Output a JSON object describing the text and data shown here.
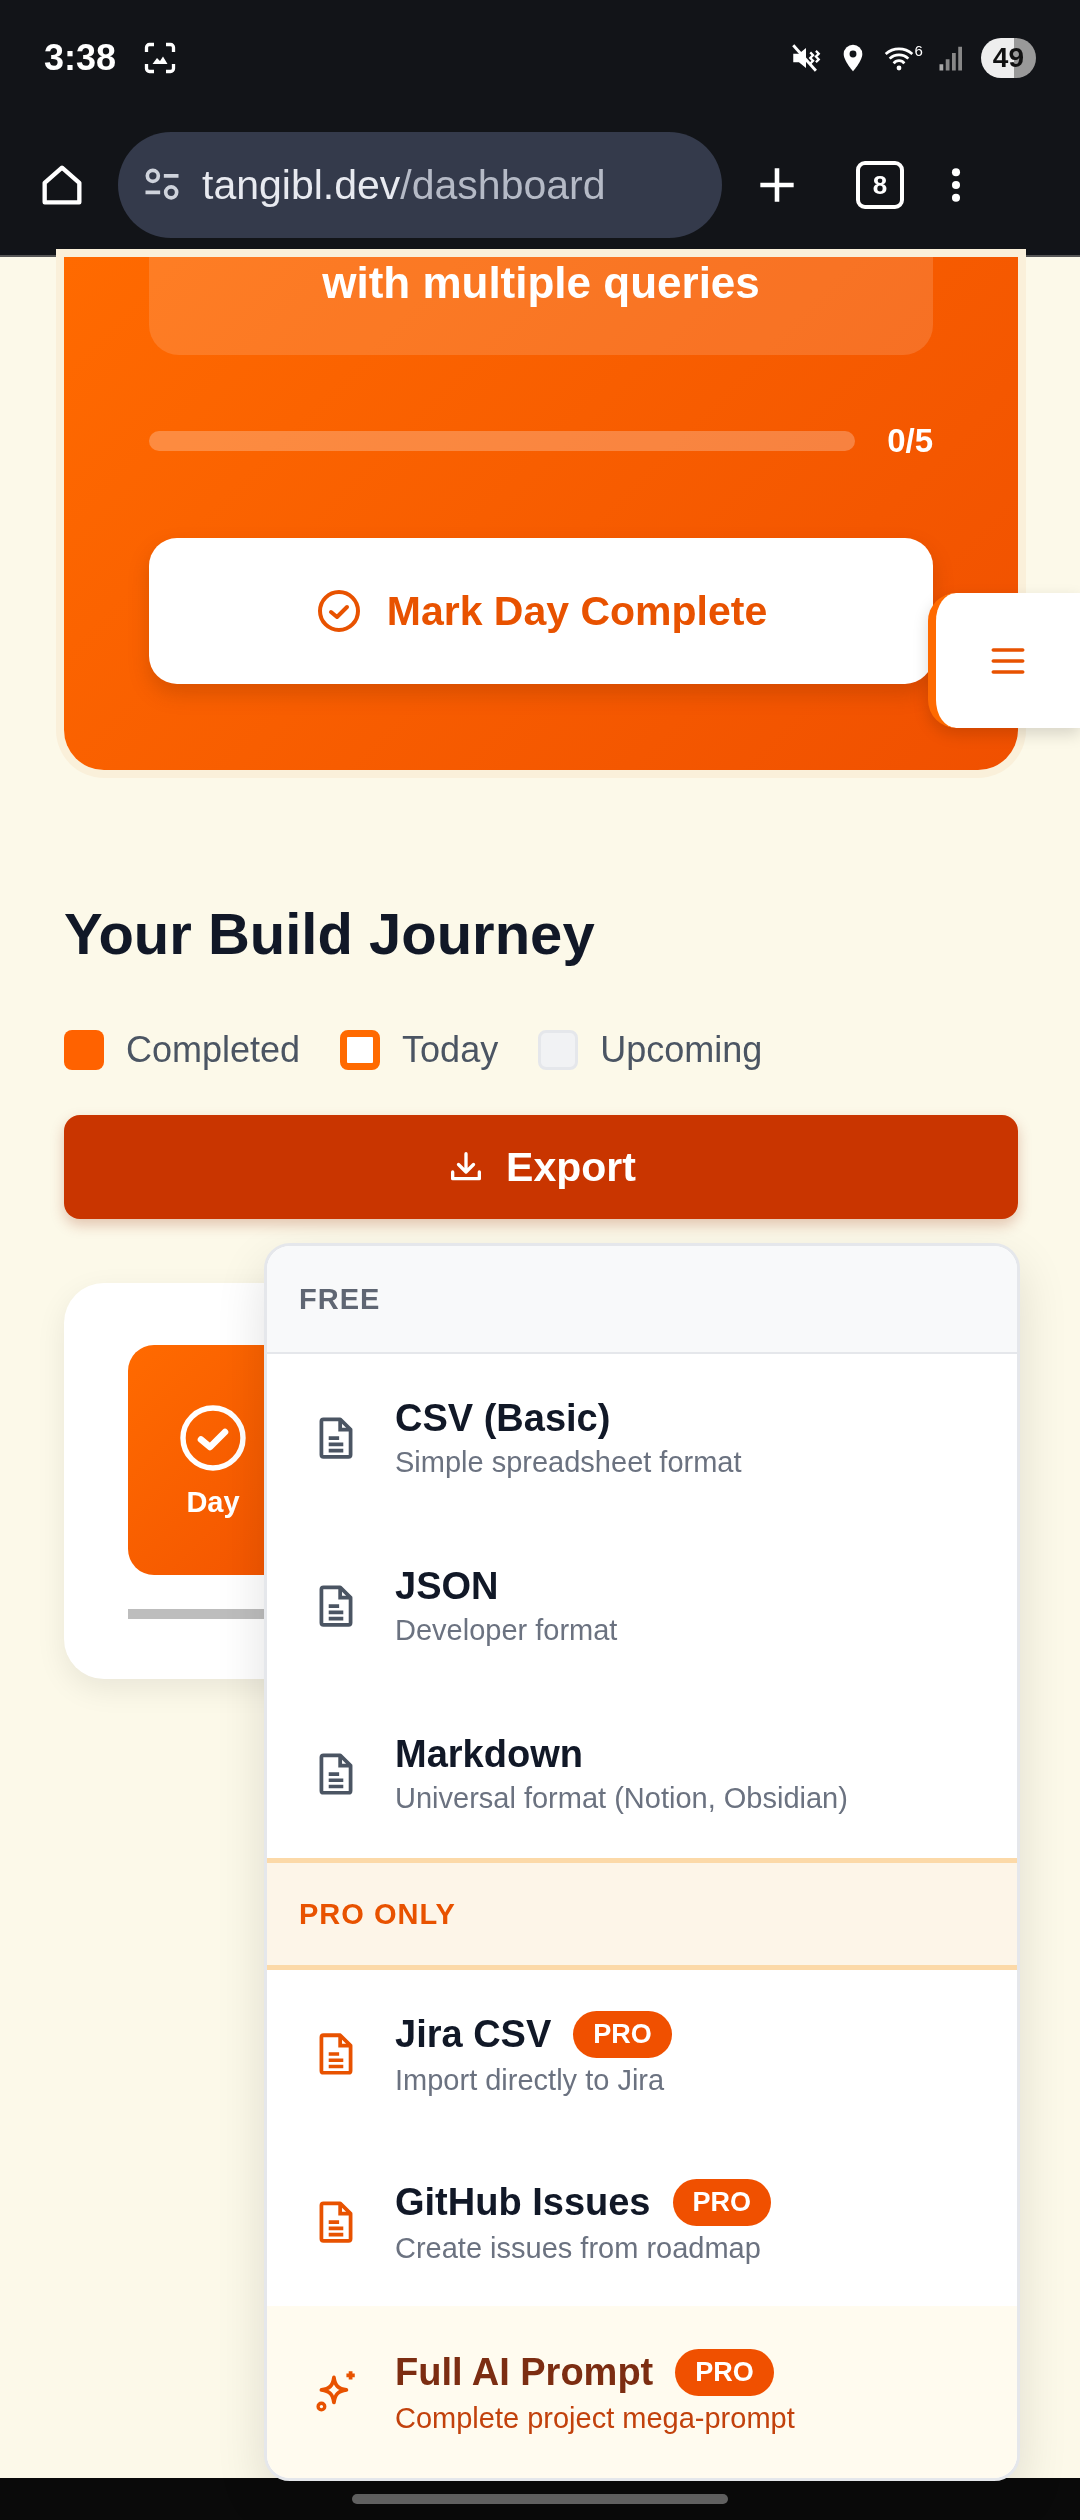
{
  "status_bar": {
    "time": "3:38",
    "battery": "49",
    "wifi_badge": "6"
  },
  "browser": {
    "url_host": "tangibl.dev",
    "url_path": "/dashboard",
    "tab_count": "8"
  },
  "task_card": {
    "task_text": "with multiple queries",
    "progress": {
      "level": 0,
      "reading": "0/5"
    },
    "complete_button": "Mark Day Complete"
  },
  "journey": {
    "title": "Your Build Journey",
    "legend": [
      {
        "kind": "completed",
        "label": "Completed"
      },
      {
        "kind": "today",
        "label": "Today"
      },
      {
        "kind": "upcoming",
        "label": "Upcoming"
      }
    ],
    "export_button": "Export",
    "day_tile": {
      "label": "Day",
      "completed": true
    }
  },
  "export_menu": {
    "sections": [
      {
        "kind": "free",
        "heading": "FREE",
        "items": [
          {
            "kind": "free",
            "title": "CSV (Basic)",
            "description": "Simple spreadsheet format"
          },
          {
            "kind": "free",
            "title": "JSON",
            "description": "Developer format"
          },
          {
            "kind": "free",
            "title": "Markdown",
            "description": "Universal format (Notion, Obsidian)"
          }
        ]
      },
      {
        "kind": "pro",
        "heading": "PRO ONLY",
        "items": [
          {
            "kind": "pro",
            "title": "Jira CSV",
            "badge": "PRO",
            "description": "Import directly to Jira"
          },
          {
            "kind": "pro",
            "title": "GitHub Issues",
            "badge": "PRO",
            "description": "Create issues from roadmap"
          },
          {
            "kind": "featured",
            "title": "Full AI Prompt",
            "badge": "PRO",
            "description": "Complete project mega-prompt"
          }
        ]
      }
    ]
  }
}
